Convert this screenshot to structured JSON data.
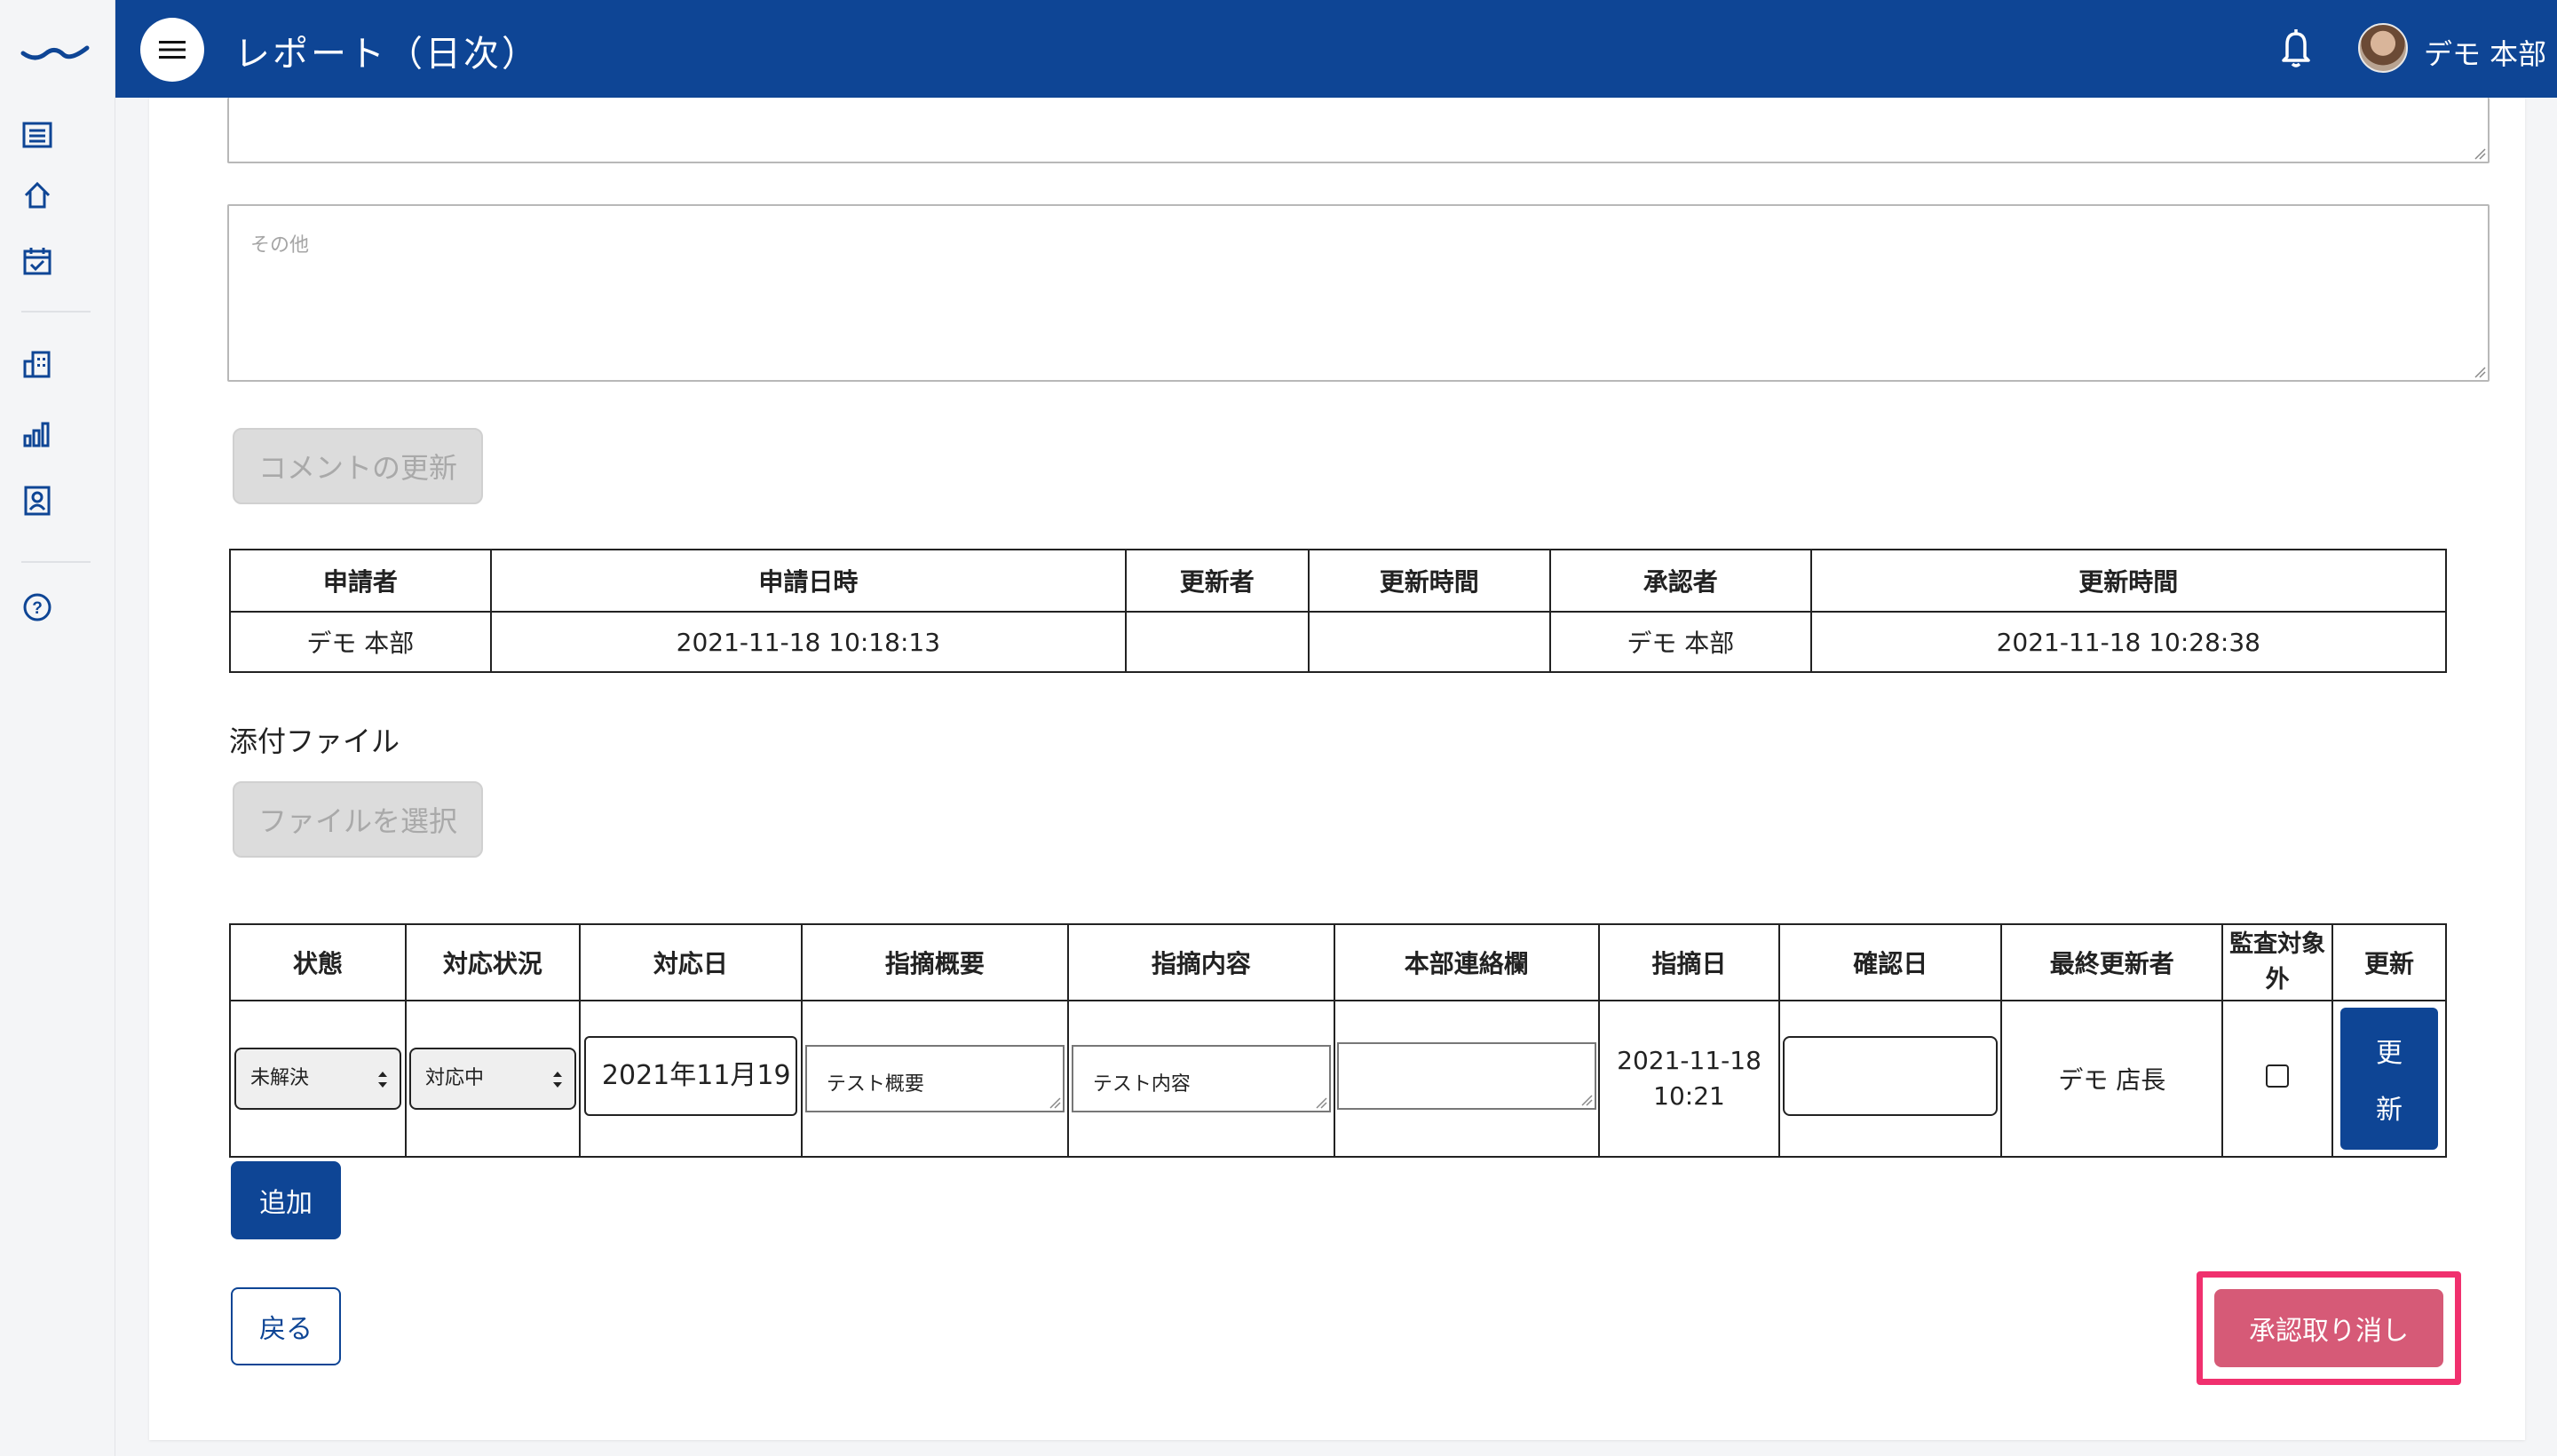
{
  "header": {
    "title": "レポート（日次）",
    "user_name": "デモ 本部"
  },
  "form": {
    "other_placeholder": "その他",
    "comment_update_button": "コメントの更新"
  },
  "info_table": {
    "headers": [
      "申請者",
      "申請日時",
      "更新者",
      "更新時間",
      "承認者",
      "更新時間"
    ],
    "row": [
      "デモ 本部",
      "2021-11-18 10:18:13",
      "",
      "",
      "デモ 本部",
      "2021-11-18 10:28:38"
    ]
  },
  "attachments": {
    "label": "添付ファイル",
    "select_button": "ファイルを選択"
  },
  "issues_table": {
    "headers": [
      "状態",
      "対応状況",
      "対応日",
      "指摘概要",
      "指摘内容",
      "本部連絡欄",
      "指摘日",
      "確認日",
      "最終更新者",
      "監査対象外",
      "更新"
    ],
    "row": {
      "status": "未解決",
      "progress": "対応中",
      "response_date": "2021年11月19",
      "summary": "テスト概要",
      "content": "テスト内容",
      "hq_note": "",
      "pointed_date_line1": "2021-11-18",
      "pointed_date_line2": "10:21",
      "confirm_date": "",
      "last_updater": "デモ 店長",
      "excluded": false,
      "update_label_1": "更",
      "update_label_2": "新"
    }
  },
  "buttons": {
    "add": "追加",
    "back": "戻る",
    "cancel_approval": "承認取り消し"
  },
  "colors": {
    "brand": "#0e4595",
    "danger": "#d65a77",
    "highlight": "#f0306e"
  }
}
